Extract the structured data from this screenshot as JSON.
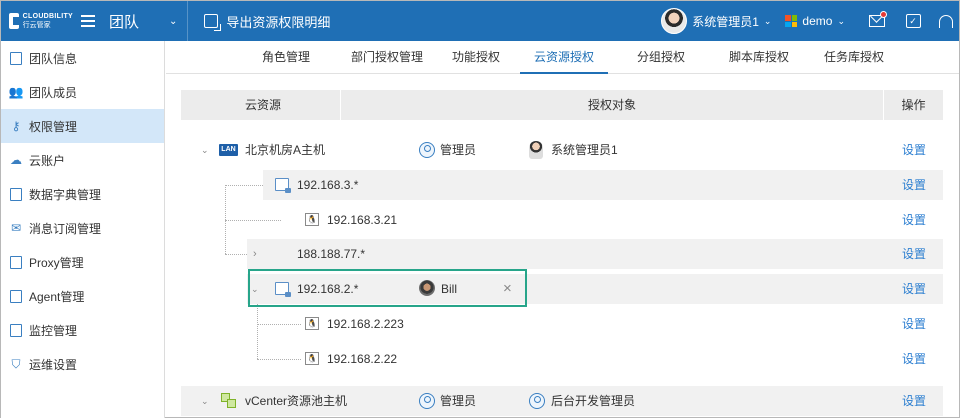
{
  "topbar": {
    "logo_en": "CLOUDBILITY",
    "logo_cn": "行云管家",
    "team_label": "团队",
    "page_title": "导出资源权限明细",
    "user_name": "系统管理员1",
    "org_name": "demo",
    "icons": [
      "menu-icon",
      "export-icon",
      "message-icon",
      "task-check-icon",
      "headset-icon"
    ]
  },
  "sidebar": {
    "items": [
      {
        "label": "团队信息",
        "icon": "document-icon",
        "active": false
      },
      {
        "label": "团队成员",
        "icon": "users-icon",
        "active": false
      },
      {
        "label": "权限管理",
        "icon": "user-key-icon",
        "active": true
      },
      {
        "label": "云账户",
        "icon": "cloud-icon",
        "active": false
      },
      {
        "label": "数据字典管理",
        "icon": "book-icon",
        "active": false
      },
      {
        "label": "消息订阅管理",
        "icon": "mail-icon",
        "active": false
      },
      {
        "label": "Proxy管理",
        "icon": "proxy-icon",
        "active": false
      },
      {
        "label": "Agent管理",
        "icon": "agent-icon",
        "active": false
      },
      {
        "label": "监控管理",
        "icon": "monitor-icon",
        "active": false
      },
      {
        "label": "运维设置",
        "icon": "shield-gear-icon",
        "active": false
      }
    ]
  },
  "tabs": [
    {
      "label": "角色管理",
      "active": false
    },
    {
      "label": "部门授权管理",
      "active": false
    },
    {
      "label": "功能授权",
      "active": false
    },
    {
      "label": "云资源授权",
      "active": true
    },
    {
      "label": "分组授权",
      "active": false
    },
    {
      "label": "脚本库授权",
      "active": false
    },
    {
      "label": "任务库授权",
      "active": false
    }
  ],
  "table": {
    "headers": {
      "resource": "云资源",
      "grantee": "授权对象",
      "action": "操作"
    },
    "rows": [
      {
        "name": "北京机房A主机",
        "type": "lan-group",
        "badge": "LAN",
        "expanded": true,
        "grantees": [
          {
            "name": "管理员",
            "kind": "role"
          },
          {
            "name": "系统管理员1",
            "kind": "user"
          }
        ],
        "action": "设置"
      },
      {
        "name": "192.168.3.*",
        "type": "network",
        "expanded": true,
        "grantees": [],
        "action": "设置"
      },
      {
        "name": "192.168.3.21",
        "type": "host",
        "grantees": [],
        "action": "设置"
      },
      {
        "name": "188.188.77.*",
        "type": "network",
        "expanded": false,
        "grantees": [],
        "action": "设置"
      },
      {
        "name": "192.168.2.*",
        "type": "network",
        "expanded": true,
        "grantees": [
          {
            "name": "Bill",
            "kind": "user",
            "removable": true
          }
        ],
        "action": "设置"
      },
      {
        "name": "192.168.2.223",
        "type": "host",
        "grantees": [],
        "action": "设置"
      },
      {
        "name": "192.168.2.22",
        "type": "host",
        "grantees": [],
        "action": "设置"
      },
      {
        "name": "vCenter资源池主机",
        "type": "vcenter-group",
        "expanded": true,
        "grantees": [
          {
            "name": "管理员",
            "kind": "role"
          },
          {
            "name": "后台开发管理员",
            "kind": "role"
          }
        ],
        "action": "设置"
      }
    ]
  },
  "colors": {
    "primary": "#1f6fb5",
    "active_bg": "#d3e7f9",
    "link": "#2b7ed0",
    "highlight": "#27a58a"
  }
}
